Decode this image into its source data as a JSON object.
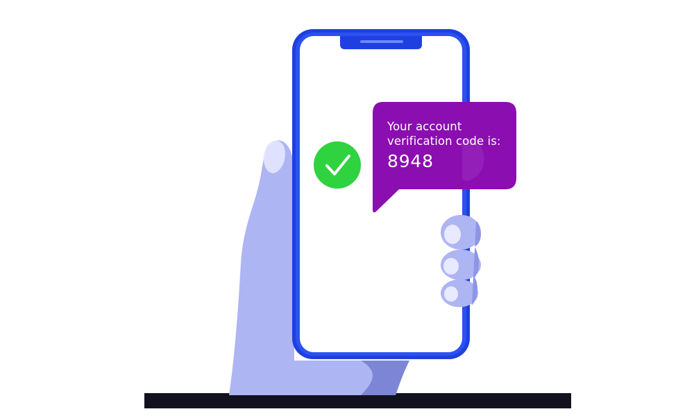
{
  "message": {
    "line1": "Your account",
    "line2": "verification code is:",
    "code": "8948"
  },
  "icons": {
    "status": "check-circle-icon",
    "device": "smartphone",
    "hand": "hand-holding-phone"
  },
  "colors": {
    "phone_frame": "#1f3fe0",
    "hand": "#aeb5f3",
    "hand_shadow": "#7c85d6",
    "bubble": "#8a0eb0",
    "check": "#2fd23f",
    "ground": "#12121f"
  }
}
